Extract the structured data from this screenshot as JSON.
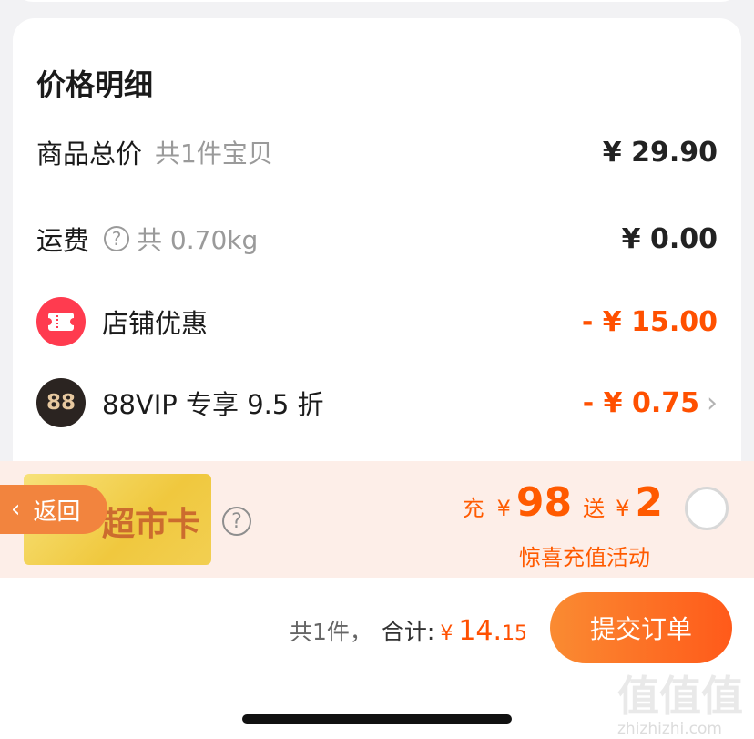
{
  "price_detail": {
    "title": "价格明细",
    "items": [
      {
        "label": "商品总价",
        "sub": "共1件宝贝",
        "value": "¥ 29.90"
      },
      {
        "label": "运费",
        "sub": "共 0.70kg",
        "value": "¥ 0.00"
      },
      {
        "label": "店铺优惠",
        "value": "- ¥ 15.00"
      },
      {
        "label": "88VIP 专享 9.5 折",
        "value": "- ¥ 0.75",
        "icon_text": "88"
      }
    ]
  },
  "promo": {
    "card_label": "超市卡",
    "back_label": "返回",
    "recharge_prefix": "充",
    "recharge_yen": "¥",
    "recharge_amount": "98",
    "bonus_prefix": "送",
    "bonus_yen": "¥",
    "bonus_amount": "2",
    "activity": "惊喜充值活动"
  },
  "footer": {
    "count": "共1件，",
    "total_label": "合计:",
    "yen": "¥",
    "amount_int": "14.",
    "amount_dec": "15",
    "submit_label": "提交订单"
  },
  "watermark": {
    "glyphs": "值值值",
    "url": "zhizhizhi.com"
  },
  "colors": {
    "accent": "#ff5000",
    "button_start": "#fa8b32",
    "button_end": "#ff5a1a",
    "promo_bg": "#fdeee8"
  }
}
